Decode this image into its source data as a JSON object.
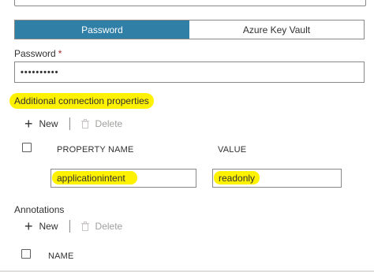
{
  "auth_toggle": {
    "options": [
      "Password",
      "Azure Key Vault"
    ],
    "selected": "Password"
  },
  "password": {
    "label": "Password",
    "required_marker": "*",
    "value": "••••••••••"
  },
  "connection_properties": {
    "title": "Additional connection properties",
    "new_label": "New",
    "delete_label": "Delete",
    "columns": [
      "PROPERTY NAME",
      "VALUE"
    ],
    "rows": [
      {
        "name": "applicationintent",
        "value": "readonly"
      }
    ]
  },
  "annotations": {
    "title": "Annotations",
    "new_label": "New",
    "delete_label": "Delete",
    "columns": [
      "NAME"
    ]
  },
  "colors": {
    "accent": "#2f7fa7",
    "highlight": "#fff200",
    "required": "#a4262c"
  }
}
